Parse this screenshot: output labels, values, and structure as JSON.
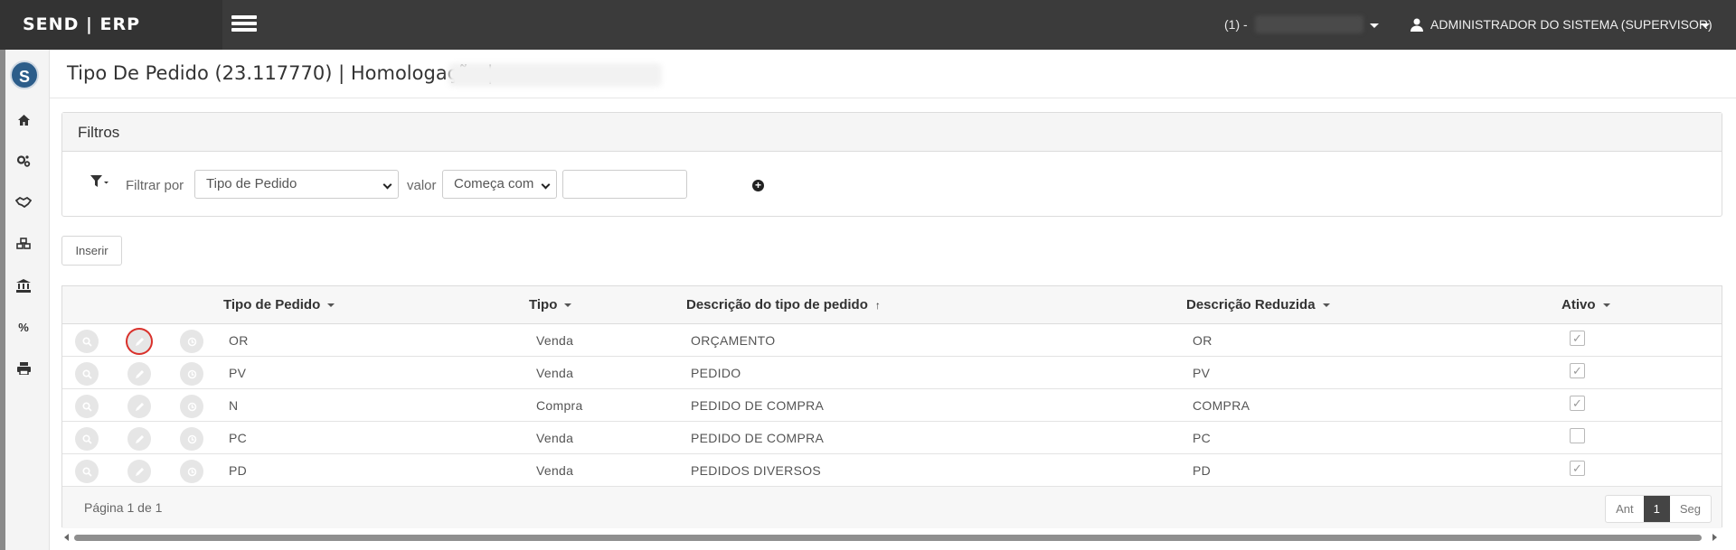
{
  "app": {
    "brand": "SEND | ERP"
  },
  "topbar": {
    "company_prefix": "(1) -",
    "user_name": "ADMINISTRADOR DO SISTEMA (SUPERVISOR)"
  },
  "sidebar": {
    "logo_letter": "S",
    "items": [
      {
        "name": "home-icon",
        "glyph": "⌂"
      },
      {
        "name": "gears-icon",
        "glyph": "⚙"
      },
      {
        "name": "handshake-icon",
        "glyph": "🤝"
      },
      {
        "name": "cubes-icon",
        "glyph": "❖"
      },
      {
        "name": "bank-icon",
        "glyph": "🏛"
      },
      {
        "name": "percent-icon",
        "glyph": "%"
      },
      {
        "name": "print-icon",
        "glyph": "⎙"
      }
    ]
  },
  "page": {
    "title": "Tipo De Pedido (23.117770) | Homologação |"
  },
  "filters": {
    "panel_title": "Filtros",
    "filter_by_label": "Filtrar por",
    "field_selected": "Tipo de Pedido",
    "value_label": "valor",
    "operator_selected": "Começa com",
    "value_input": ""
  },
  "toolbar": {
    "insert_label": "Inserir"
  },
  "grid": {
    "columns": [
      "Tipo de Pedido",
      "Tipo",
      "Descrição do tipo de pedido",
      "Descrição Reduzida",
      "Ativo"
    ],
    "rows": [
      {
        "codigo": "OR",
        "tipo": "Venda",
        "descricao": "ORÇAMENTO",
        "reduzida": "OR",
        "ativo": true
      },
      {
        "codigo": "PV",
        "tipo": "Venda",
        "descricao": "PEDIDO",
        "reduzida": "PV",
        "ativo": true
      },
      {
        "codigo": "N",
        "tipo": "Compra",
        "descricao": "PEDIDO DE COMPRA",
        "reduzida": "COMPRA",
        "ativo": true
      },
      {
        "codigo": "PC",
        "tipo": "Venda",
        "descricao": "PEDIDO DE COMPRA",
        "reduzida": "PC",
        "ativo": false
      },
      {
        "codigo": "PD",
        "tipo": "Venda",
        "descricao": "PEDIDOS DIVERSOS",
        "reduzida": "PD",
        "ativo": true
      }
    ],
    "pagination": {
      "info": "Página 1 de 1",
      "prev": "Ant",
      "current": "1",
      "next": "Seg"
    }
  }
}
